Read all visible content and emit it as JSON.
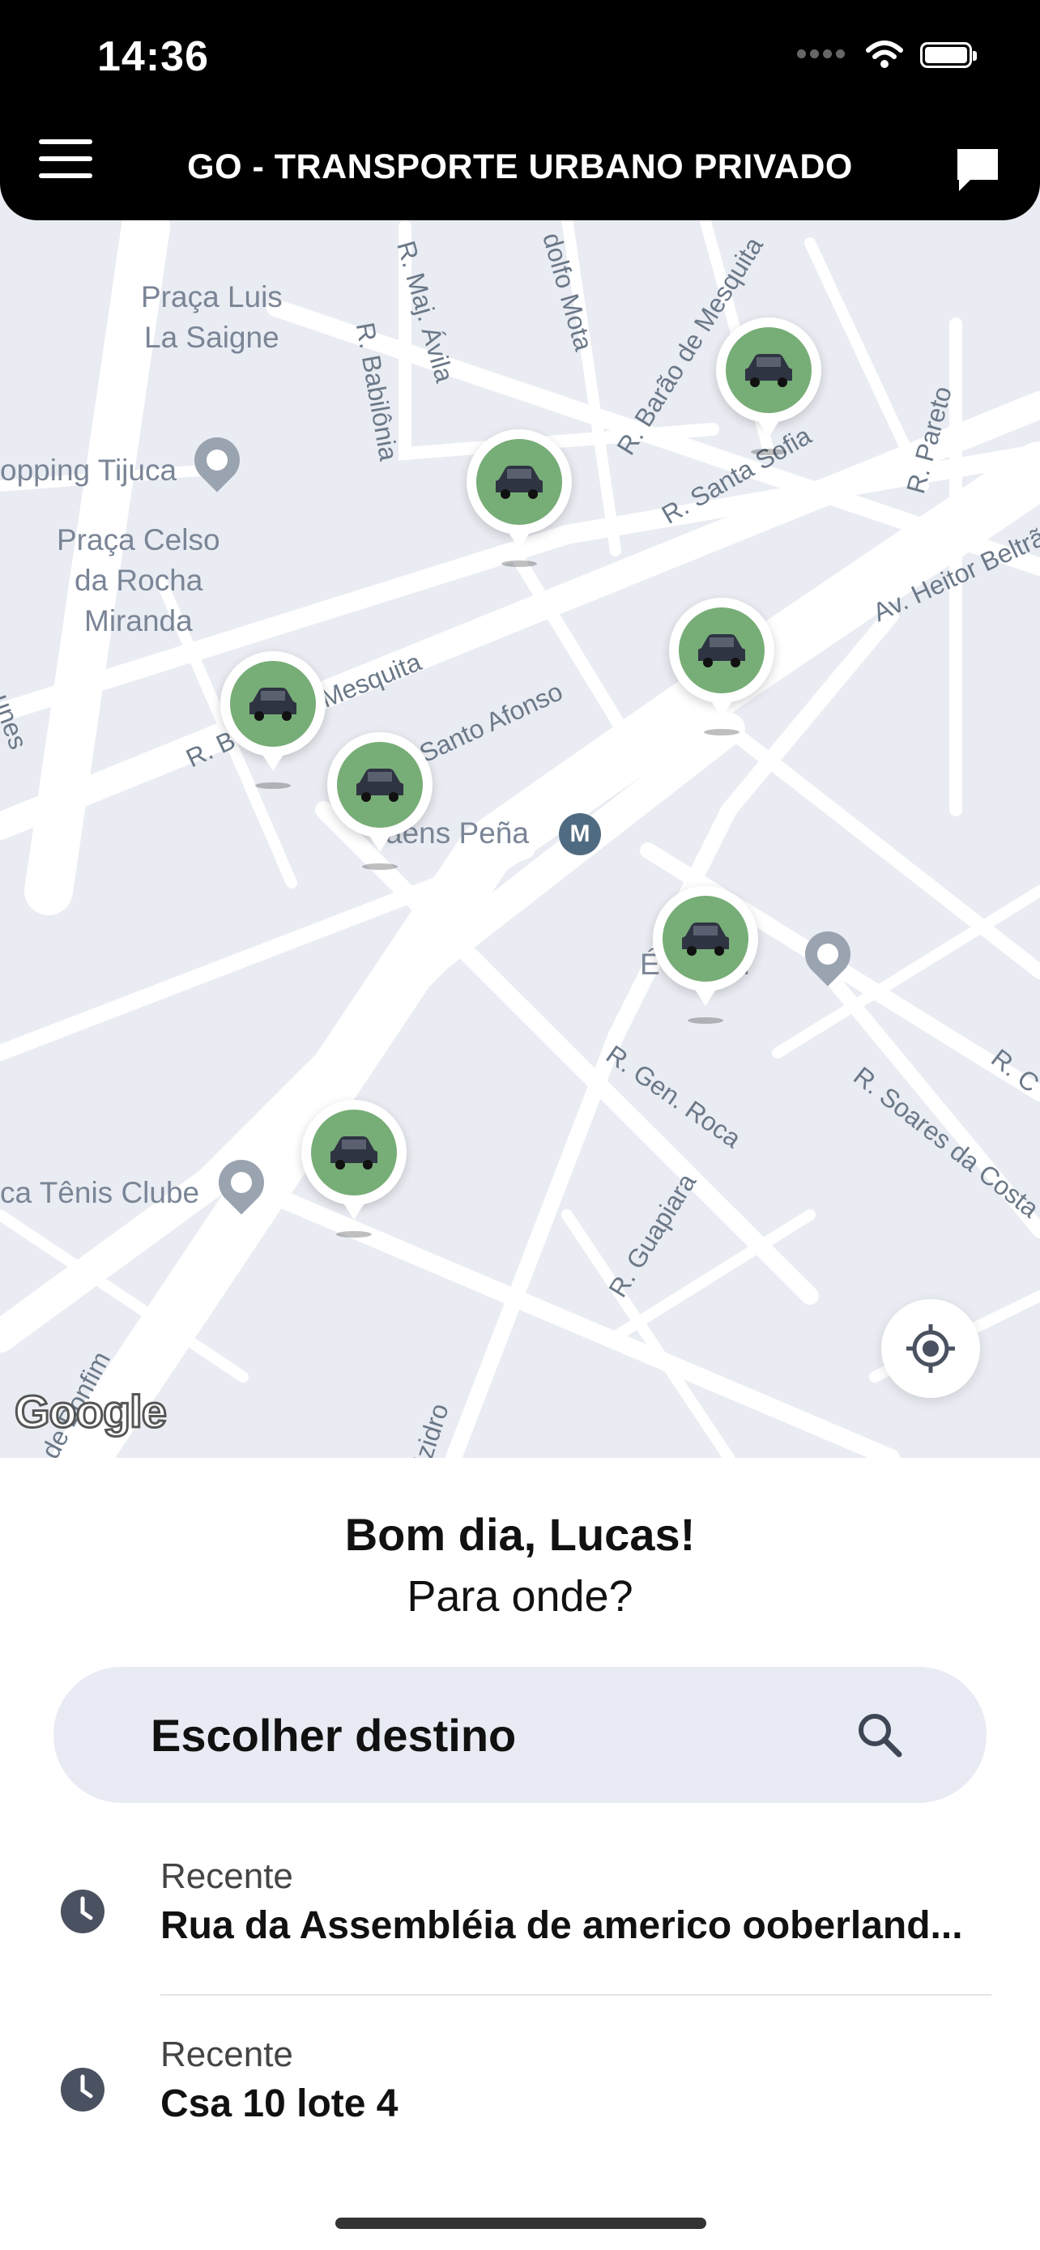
{
  "status_bar": {
    "time": "14:36"
  },
  "header": {
    "title": "GO - TRANSPORTE URBANO PRIVADO"
  },
  "map": {
    "places": [
      "Praça Luis",
      "La Saigne",
      "opping Tijuca",
      "Praça Celso",
      "da Rocha",
      "Miranda",
      "ca Tênis Clube",
      "aens Peña",
      "É",
      "otel"
    ],
    "streets": [
      "R. Maj. Ávila",
      "dolfo Mota",
      "R. Barão de Mesquita",
      "R. Babilônia",
      "R. Santa Sofia",
      "R. Pareto",
      "Av. Heitor Beltrã",
      "R. B",
      "Mesquita",
      "Santo Afonso",
      "unes",
      "R. Gen. Roca",
      "R. Soares da Costa",
      "R. C",
      "R. Guapiara",
      "de Bonfim",
      "Izidro"
    ],
    "metro_symbol": "M",
    "attribution": "Google"
  },
  "sheet": {
    "greeting": "Bom dia, Lucas!",
    "question": "Para onde?",
    "search_label": "Escolher destino",
    "recents": [
      {
        "label": "Recente",
        "value": "Rua da Assembléia de americo ooberland..."
      },
      {
        "label": "Recente",
        "value": "Csa 10 lote 4"
      }
    ]
  },
  "colors": {
    "accent": "#77ad77",
    "header": "#000000",
    "map_bg": "#e9ecf2",
    "search_bg": "#e8ebf3"
  },
  "icons": [
    "menu-icon",
    "chat-icon",
    "car-icon",
    "locate-icon",
    "search-icon",
    "clock-icon",
    "wifi-icon",
    "battery-icon"
  ]
}
